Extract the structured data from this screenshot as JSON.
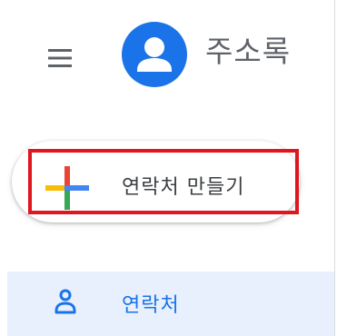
{
  "header": {
    "app_title": "주소록",
    "menu_icon": "hamburger-menu-icon",
    "logo_icon": "contacts-person-icon"
  },
  "create_button": {
    "label": "연락처 만들기",
    "icon": "multicolor-plus-icon",
    "highlighted": true
  },
  "sidebar": {
    "items": [
      {
        "label": "연락처",
        "icon": "person-outline-icon",
        "selected": true
      }
    ]
  },
  "colors": {
    "brand_blue": "#1a73e8",
    "selected_bg": "#e8f0fe",
    "highlight_red": "#e0161e",
    "plus_red": "#ea4335",
    "plus_yellow": "#fbbc04",
    "plus_green": "#34a853",
    "plus_blue": "#4285f4",
    "text_gray": "#5f6368"
  }
}
